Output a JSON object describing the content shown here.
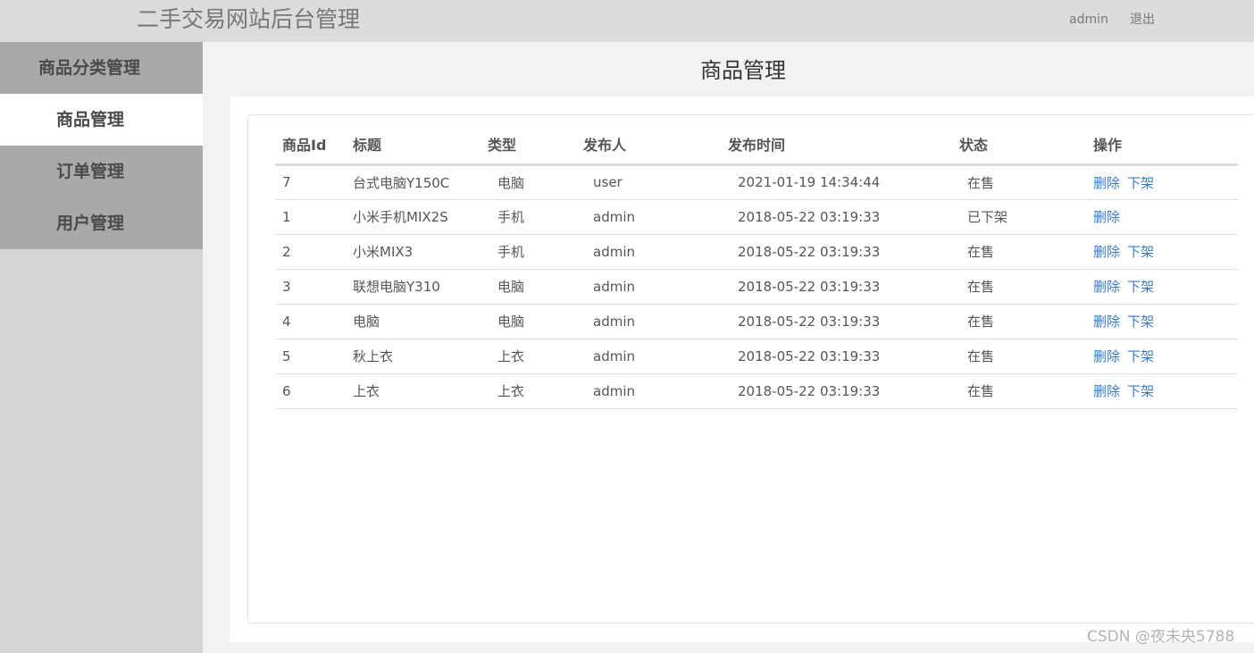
{
  "header": {
    "title": "二手交易网站后台管理",
    "user": "admin",
    "logout": "退出"
  },
  "sidebar": {
    "items": [
      {
        "label": "商品分类管理",
        "active": false
      },
      {
        "label": "商品管理",
        "active": true
      },
      {
        "label": "订单管理",
        "active": false
      },
      {
        "label": "用户管理",
        "active": false
      }
    ]
  },
  "main": {
    "title": "商品管理",
    "columns": [
      "商品Id",
      "标题",
      "类型",
      "发布人",
      "发布时间",
      "状态",
      "操作"
    ],
    "delete_label": "删除",
    "offshelf_label": "下架",
    "rows": [
      {
        "id": "7",
        "title": "台式电脑Y150C",
        "type": "电脑",
        "publisher": "user",
        "time": "2021-01-19 14:34:44",
        "status": "在售",
        "can_offshelf": true
      },
      {
        "id": "1",
        "title": "小米手机MIX2S",
        "type": "手机",
        "publisher": "admin",
        "time": "2018-05-22 03:19:33",
        "status": "已下架",
        "can_offshelf": false
      },
      {
        "id": "2",
        "title": "小米MIX3",
        "type": "手机",
        "publisher": "admin",
        "time": "2018-05-22 03:19:33",
        "status": "在售",
        "can_offshelf": true
      },
      {
        "id": "3",
        "title": "联想电脑Y310",
        "type": "电脑",
        "publisher": "admin",
        "time": "2018-05-22 03:19:33",
        "status": "在售",
        "can_offshelf": true
      },
      {
        "id": "4",
        "title": "电脑",
        "type": "电脑",
        "publisher": "admin",
        "time": "2018-05-22 03:19:33",
        "status": "在售",
        "can_offshelf": true
      },
      {
        "id": "5",
        "title": "秋上衣",
        "type": "上衣",
        "publisher": "admin",
        "time": "2018-05-22 03:19:33",
        "status": "在售",
        "can_offshelf": true
      },
      {
        "id": "6",
        "title": "上衣",
        "type": "上衣",
        "publisher": "admin",
        "time": "2018-05-22 03:19:33",
        "status": "在售",
        "can_offshelf": true
      }
    ]
  },
  "watermark": "CSDN @夜未央5788"
}
